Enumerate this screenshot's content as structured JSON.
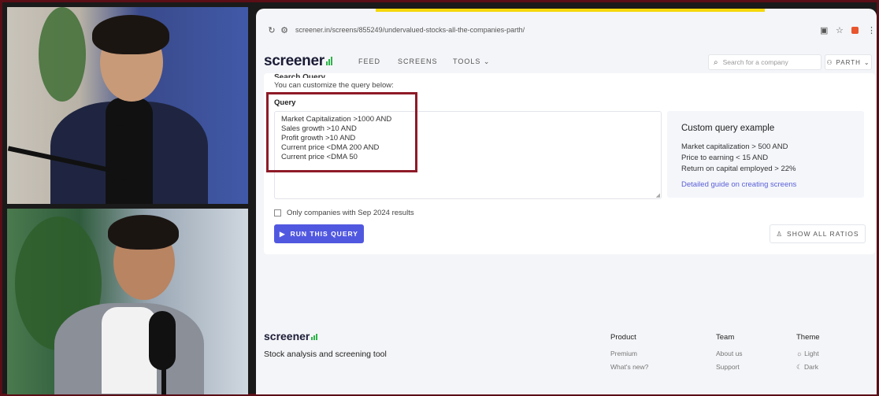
{
  "browser": {
    "url": "screener.in/screens/855249/undervalued-stocks-all-the-companies-parth/",
    "reload_icon": "reload-icon",
    "site_info_icon": "site-info-icon"
  },
  "nav": {
    "logo": "screener",
    "links": [
      "FEED",
      "SCREENS",
      "TOOLS"
    ],
    "search_placeholder": "Search for a company",
    "user": "PARTH"
  },
  "query": {
    "section_title": "Search Query",
    "customize_text": "You can customize the query below:",
    "label": "Query",
    "lines": [
      "Market Capitalization >1000 AND",
      "Sales growth >10 AND",
      "Profit growth >10 AND",
      "Current price <DMA 200 AND",
      "Current price <DMA 50"
    ]
  },
  "example": {
    "title": "Custom query example",
    "lines": [
      "Market capitalization > 500 AND",
      "Price to earning < 15 AND",
      "Return on capital employed > 22%"
    ],
    "guide_link": "Detailed guide on creating screens"
  },
  "options": {
    "checkbox_label": "Only companies with Sep 2024 results",
    "run_button": "RUN THIS QUERY",
    "ratios_button": "SHOW ALL RATIOS"
  },
  "footer": {
    "logo": "screener",
    "tagline": "Stock analysis and screening tool",
    "columns": [
      {
        "heading": "Product",
        "links": [
          "Premium",
          "What's new?"
        ]
      },
      {
        "heading": "Team",
        "links": [
          "About us",
          "Support"
        ]
      },
      {
        "heading": "Theme",
        "links": [
          "Light",
          "Dark"
        ]
      }
    ]
  },
  "colors": {
    "accent": "#5158e0",
    "highlight_border": "#8e1a27",
    "logo_bars": "#2db34a",
    "frame": "#5a0e16"
  }
}
